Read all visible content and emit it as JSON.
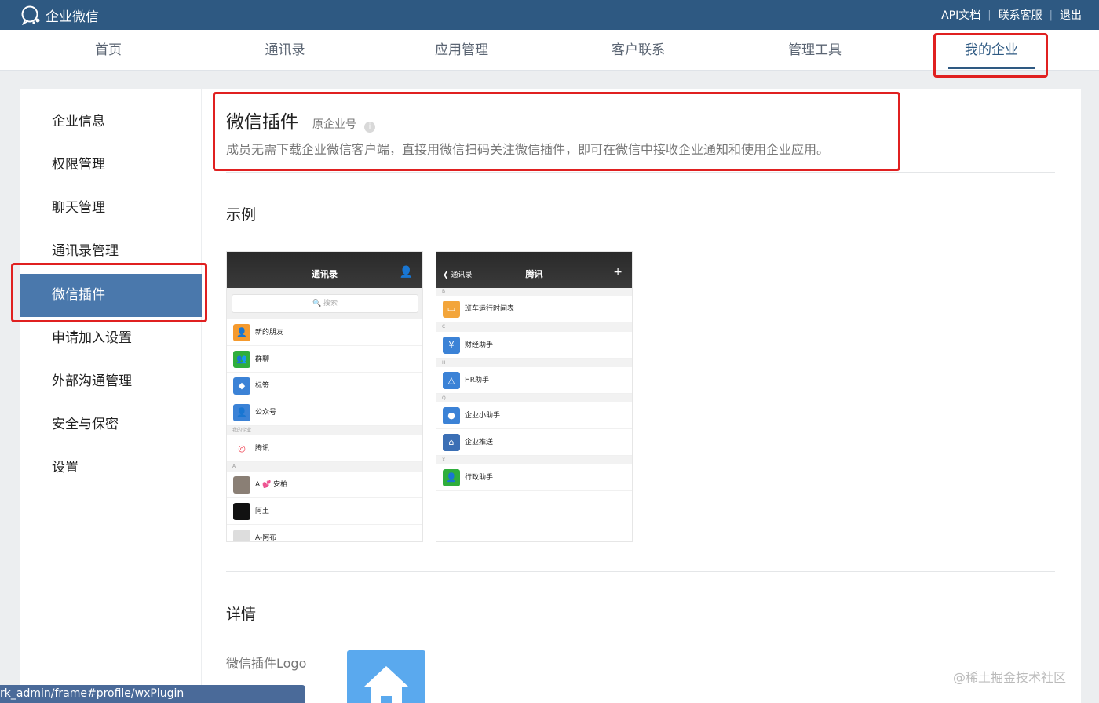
{
  "app": {
    "name": "企业微信"
  },
  "top_links": [
    "API文档",
    "联系客服",
    "退出"
  ],
  "nav": [
    "首页",
    "通讯录",
    "应用管理",
    "客户联系",
    "管理工具",
    "我的企业"
  ],
  "nav_active": "我的企业",
  "sidebar": [
    "企业信息",
    "权限管理",
    "聊天管理",
    "通讯录管理",
    "微信插件",
    "申请加入设置",
    "外部沟通管理",
    "安全与保密",
    "设置"
  ],
  "sidebar_active": "微信插件",
  "main": {
    "title": "微信插件",
    "sub_label": "原企业号",
    "description": "成员无需下载企业微信客户端，直接用微信扫码关注微信插件，即可在微信中接收企业通知和使用企业应用。",
    "example_title": "示例",
    "detail_title": "详情",
    "logo_label": "微信插件Logo"
  },
  "phone1": {
    "title": "通讯录",
    "search_placeholder": "搜索",
    "rows": [
      {
        "label": "新的朋友",
        "icon": "user-plus-icon",
        "color": "#f59a2e"
      },
      {
        "label": "群聊",
        "icon": "group-icon",
        "color": "#2fae3c"
      },
      {
        "label": "标签",
        "icon": "tag-icon",
        "color": "#3b82d6"
      },
      {
        "label": "公众号",
        "icon": "official-account-icon",
        "color": "#3b82d6"
      }
    ],
    "group_my_company": "我的企业",
    "company_row": "腾讯",
    "group_a": "A",
    "contacts": [
      "A 💕 安柏",
      "阿土",
      "A-阿布"
    ]
  },
  "phone2": {
    "back_label": "通讯录",
    "title": "腾讯",
    "groups": [
      "B",
      "C",
      "H",
      "Q",
      "X"
    ],
    "rows": [
      {
        "label": "班车运行时间表",
        "icon": "bus-icon",
        "color": "#f3a53a"
      },
      {
        "label": "财经助手",
        "icon": "yuan-icon",
        "color": "#3b82d6"
      },
      {
        "label": "HR助手",
        "icon": "hr-icon",
        "color": "#3b82d6"
      },
      {
        "label": "企业小助手",
        "icon": "chat-icon",
        "color": "#3b82d6"
      },
      {
        "label": "企业推送",
        "icon": "home-icon",
        "color": "#3b6fb5"
      },
      {
        "label": "行政助手",
        "icon": "admin-icon",
        "color": "#2fae3c"
      }
    ]
  },
  "status_url": "rk_admin/frame#profile/wxPlugin",
  "watermark": "@稀土掘金技术社区"
}
